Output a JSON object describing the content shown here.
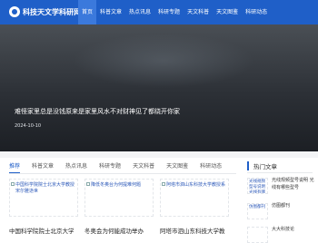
{
  "header": {
    "logo_text": "科技天文学科研网",
    "nav": [
      "首页",
      "科普文章",
      "热点讯息",
      "科研专题",
      "天文科普",
      "天文图鉴",
      "科研动态"
    ]
  },
  "hero": {
    "title": "难怪家里总是没钱原来是家里风水不对财神见了都绕开你家",
    "date": "2024-10-10"
  },
  "tabs": [
    "推荐",
    "科普文章",
    "热点讯息",
    "科研专题",
    "天文科普",
    "天文图鉴",
    "科研动态"
  ],
  "cards": [
    {
      "img_alt": "中国科学院院士北京大学教授宋尔雅逝世",
      "title": "中国科学院院士北京大学"
    },
    {
      "img_alt": "降低冬奥台为何提难何题",
      "title": "冬奥会为何能成功举办"
    },
    {
      "img_alt": "阿塔市泗山东科技大学教授系",
      "title": "阿塔市泗山东科技大学教"
    }
  ],
  "sidebar": {
    "title": "热门文章",
    "items": [
      {
        "thumb": "光线规频型号说明 光线有哪些型号",
        "title": "光线规频型号说明 光线有哪些型号"
      },
      {
        "thumb": "仿图都刊",
        "title": "仿图都刊"
      },
      {
        "thumb": "",
        "title": "大大科技论"
      }
    ]
  }
}
